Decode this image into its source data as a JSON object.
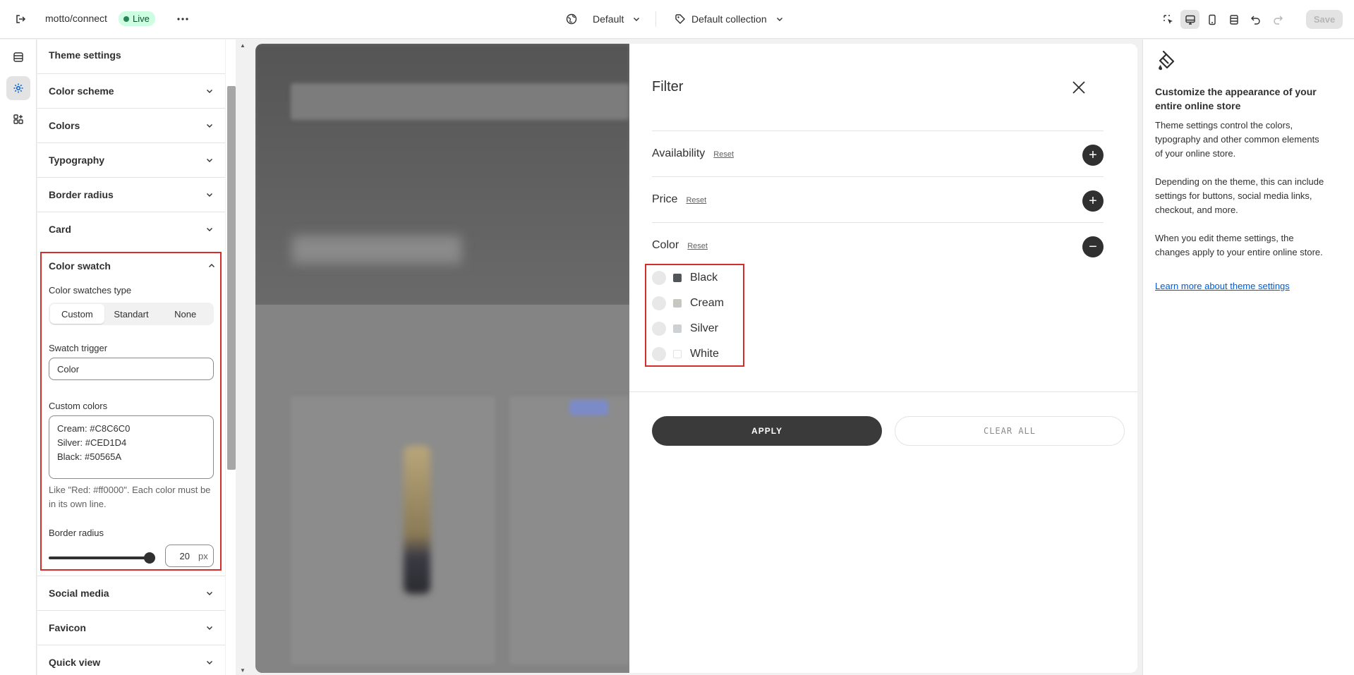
{
  "topbar": {
    "store_name": "motto/connect",
    "live_label": "Live",
    "theme_label": "Default",
    "collection_label": "Default collection",
    "save_label": "Save"
  },
  "settings": {
    "title": "Theme settings",
    "sections_top": [
      {
        "label": "Color scheme"
      },
      {
        "label": "Colors"
      },
      {
        "label": "Typography"
      },
      {
        "label": "Border radius"
      },
      {
        "label": "Card"
      }
    ],
    "swatch": {
      "label": "Color swatch",
      "type_label": "Color swatches type",
      "type_options": [
        "Custom",
        "Standart",
        "None"
      ],
      "type_selected": "Custom",
      "trigger_label": "Swatch trigger",
      "trigger_value": "Color",
      "custom_colors_label": "Custom colors",
      "custom_colors_lines": [
        "Cream: #C8C6C0",
        "Silver: #CED1D4",
        "Black: #50565A"
      ],
      "help": "Like \"Red: #ff0000\". Each color must be in its own line.",
      "radius_label": "Border radius",
      "radius_value": "20",
      "radius_unit": "px",
      "radius_fraction": 1.0
    },
    "sections_bottom": [
      {
        "label": "Social media"
      },
      {
        "label": "Favicon"
      },
      {
        "label": "Quick view"
      }
    ]
  },
  "filter": {
    "title": "Filter",
    "rows": [
      {
        "name": "Availability",
        "reset": "Reset",
        "state": "collapsed"
      },
      {
        "name": "Price",
        "reset": "Reset",
        "state": "collapsed"
      },
      {
        "name": "Color",
        "reset": "Reset",
        "state": "expanded"
      }
    ],
    "colors": [
      {
        "label": "Black",
        "swatch": "#50565A"
      },
      {
        "label": "Cream",
        "swatch": "#C8C6C0"
      },
      {
        "label": "Silver",
        "swatch": "#CED1D4"
      },
      {
        "label": "White",
        "swatch": "#FFFFFF"
      }
    ],
    "apply_label": "APPLY",
    "clear_label": "CLEAR ALL"
  },
  "info": {
    "title": "Customize the appearance of your entire online store",
    "p1": "Theme settings control the colors, typography and other common elements of your online store.",
    "p2": "Depending on the theme, this can include settings for buttons, social media links, checkout, and more.",
    "p3": "When you edit theme settings, the changes apply to your entire online store.",
    "link": "Learn more about theme settings"
  },
  "colors": {
    "accent": "#303030",
    "live_bg": "#cdfee1",
    "highlight": "#d72c2c",
    "link": "#005bd3"
  }
}
